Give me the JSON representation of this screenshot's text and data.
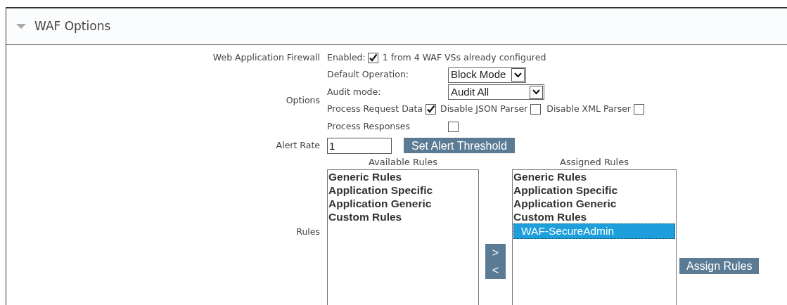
{
  "header": {
    "title": "WAF Options",
    "expanded": true
  },
  "firewall": {
    "label": "Web Application Firewall",
    "enabled_label": "Enabled:",
    "enabled": true,
    "note": "1 from 4 WAF VSs already configured"
  },
  "options": {
    "label": "Options",
    "default_operation": {
      "label": "Default Operation:",
      "value": "Block Mode"
    },
    "audit_mode": {
      "label": "Audit mode:",
      "value": "Audit All"
    },
    "process_request_data": {
      "label": "Process Request Data",
      "checked": true
    },
    "disable_json_parser": {
      "label": "Disable JSON Parser",
      "checked": false
    },
    "disable_xml_parser": {
      "label": "Disable XML Parser",
      "checked": false
    },
    "process_responses": {
      "label": "Process Responses",
      "checked": false
    }
  },
  "alert_rate": {
    "label": "Alert Rate",
    "value": "1",
    "button": "Set Alert Threshold"
  },
  "rules": {
    "label": "Rules",
    "available": {
      "heading": "Available Rules",
      "groups": [
        {
          "text": "Generic Rules"
        },
        {
          "text": "Application Specific"
        },
        {
          "text": "Application Generic"
        },
        {
          "text": "Custom Rules"
        }
      ]
    },
    "move_buttons": [
      ">",
      "<"
    ],
    "assigned": {
      "heading": "Assigned Rules",
      "groups": [
        {
          "text": "Generic Rules"
        },
        {
          "text": "Application Specific"
        },
        {
          "text": "Application Generic"
        },
        {
          "text": "Custom Rules",
          "children": [
            {
              "text": "WAF-SecureAdmin",
              "selected": true
            }
          ]
        }
      ]
    },
    "assign_button": "Assign Rules"
  }
}
